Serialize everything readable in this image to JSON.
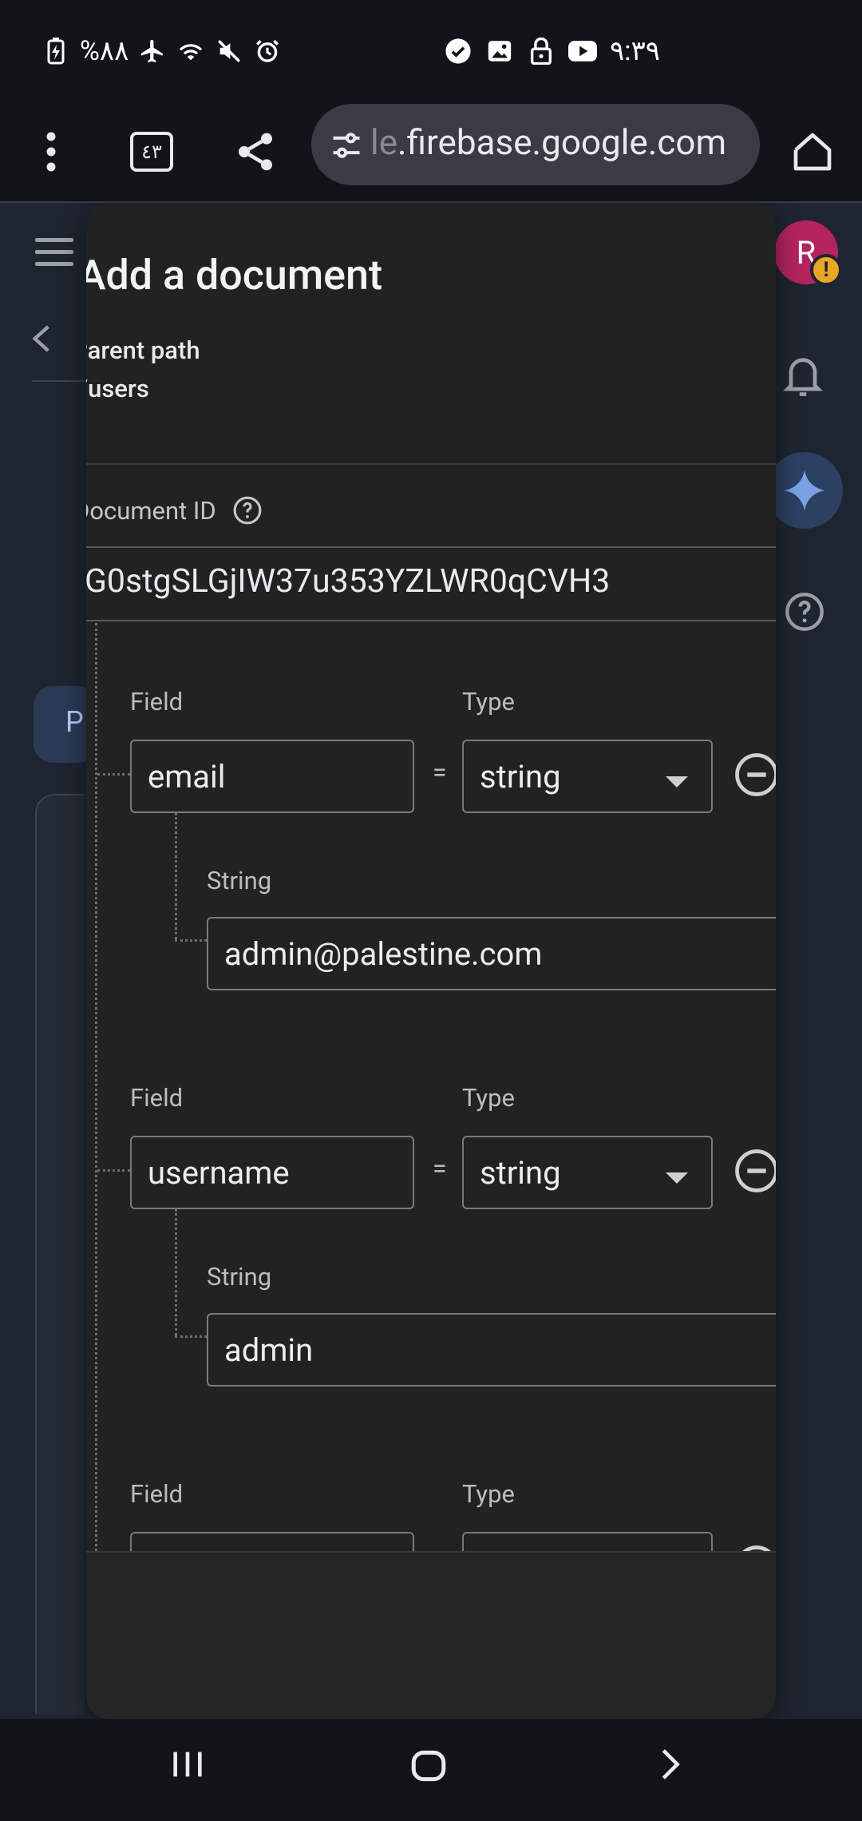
{
  "status_bar": {
    "battery": "%٨٨",
    "time": "٩:٣٩"
  },
  "browser": {
    "tab_count": "٤٣",
    "url_faded": "le",
    "url": ".firebase.google.com"
  },
  "background": {
    "chip_letter": "P",
    "avatar_letter": "R"
  },
  "modal": {
    "title": "Add a document",
    "parent_path_label": "Parent path",
    "parent_path_value": "/users",
    "document_id_label": "Document ID",
    "document_id_value": "G0stgSLGjIW37u353YZLWR0qCVH3",
    "fields": [
      {
        "field_label": "Field",
        "field_value": "email",
        "type_label": "Type",
        "type_value": "string",
        "value_label": "String",
        "value": "admin@palestine.com"
      },
      {
        "field_label": "Field",
        "field_value": "username",
        "type_label": "Type",
        "type_value": "string",
        "value_label": "String",
        "value": "admin"
      },
      {
        "field_label": "Field",
        "type_label": "Type"
      }
    ],
    "equals": "="
  },
  "icons": {
    "menu": "more-vert-icon",
    "share": "share-icon",
    "home": "home-icon",
    "minus": "remove-circle-icon"
  }
}
